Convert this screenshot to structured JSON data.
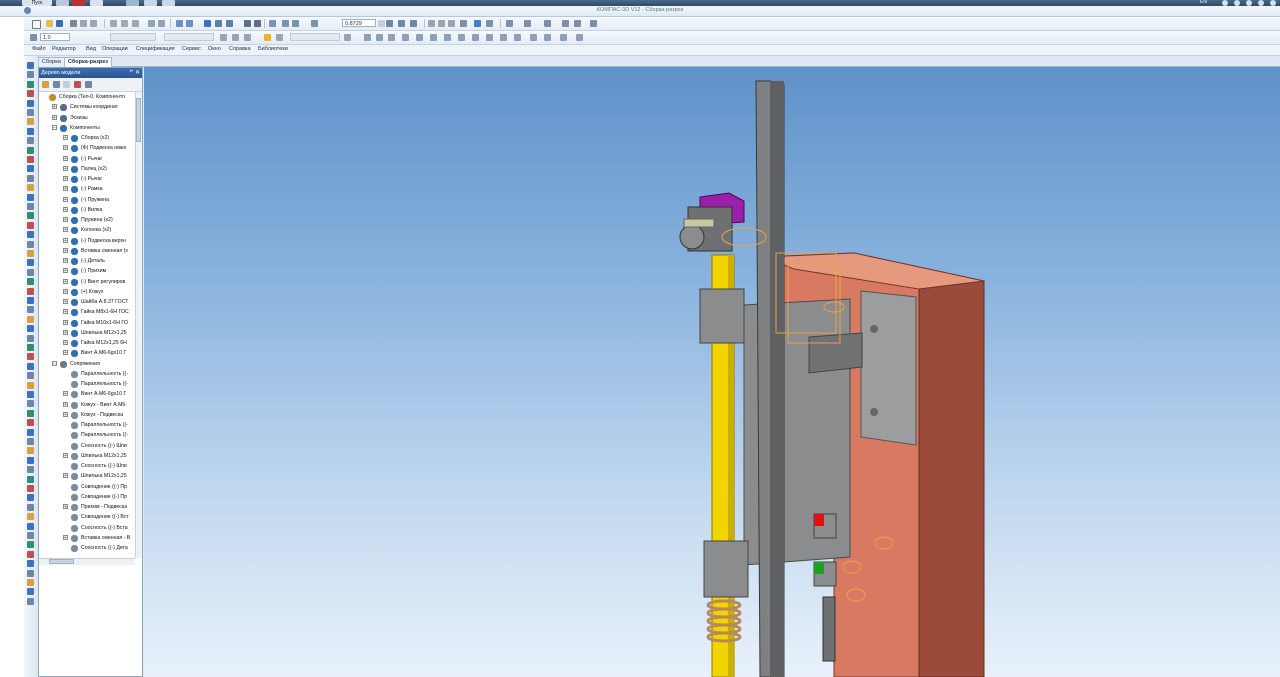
{
  "taskbar": {
    "start_label": "Пуск",
    "tray_text": "EN"
  },
  "app": {
    "title": "КОМПАС-3D V12 - Сборка-разрез"
  },
  "toolbar": {
    "zoom_value": "0.8729",
    "scale_value": "1.0"
  },
  "menu": [
    "Файл",
    "Редактор",
    "Вид",
    "Операции",
    "Спецификация",
    "Сервис",
    "Окно",
    "Справка",
    "Библиотеки"
  ],
  "doc_tabs": [
    {
      "label": "Сборка",
      "active": false
    },
    {
      "label": "Сборка-разрез",
      "active": true
    }
  ],
  "tree": {
    "title": "Дерево модели",
    "pin": "ꟸ",
    "close": "✕",
    "rows": [
      {
        "label": "Сборка (Тел-0, Компоненто",
        "indent": 0,
        "exp": "",
        "icon": "assembly-root-icon",
        "color": "#c98a2a"
      },
      {
        "label": "Системы координат",
        "indent": 1,
        "exp": "+",
        "icon": "coordinate-system-icon",
        "color": "#5a6a8a"
      },
      {
        "label": "Эскизы",
        "indent": 1,
        "exp": "+",
        "icon": "sketch-icon",
        "color": "#5a6a8a"
      },
      {
        "label": "Компоненты",
        "indent": 1,
        "exp": "−",
        "icon": "components-icon",
        "color": "#2f6fb5"
      },
      {
        "label": "Сборка (x2)",
        "indent": 2,
        "exp": "+",
        "icon": "assembly-icon",
        "color": "#2f6fb5"
      },
      {
        "label": "(Ф) Подвеска нижн",
        "indent": 2,
        "exp": "+",
        "icon": "part-icon",
        "color": "#2f6fb5"
      },
      {
        "label": "(-) Рычаг",
        "indent": 2,
        "exp": "+",
        "icon": "part-icon",
        "color": "#2f6fb5"
      },
      {
        "label": "Палец (x2)",
        "indent": 2,
        "exp": "+",
        "icon": "part-icon",
        "color": "#2f6fb5"
      },
      {
        "label": "(-) Рычаг",
        "indent": 2,
        "exp": "+",
        "icon": "part-icon",
        "color": "#2f6fb5"
      },
      {
        "label": "(-) Рамка",
        "indent": 2,
        "exp": "+",
        "icon": "part-icon",
        "color": "#2f6fb5"
      },
      {
        "label": "(-) Пружина",
        "indent": 2,
        "exp": "+",
        "icon": "part-icon",
        "color": "#2f6fb5"
      },
      {
        "label": "(-) Вилка",
        "indent": 2,
        "exp": "+",
        "icon": "part-icon",
        "color": "#2f6fb5"
      },
      {
        "label": "Пружина (x2)",
        "indent": 2,
        "exp": "+",
        "icon": "part-icon",
        "color": "#2f6fb5"
      },
      {
        "label": "Колонка (x2)",
        "indent": 2,
        "exp": "+",
        "icon": "part-icon",
        "color": "#2f6fb5"
      },
      {
        "label": "(-) Подвеска верхн",
        "indent": 2,
        "exp": "+",
        "icon": "part-icon",
        "color": "#2f6fb5"
      },
      {
        "label": "Вставка сменная (x",
        "indent": 2,
        "exp": "+",
        "icon": "part-icon",
        "color": "#2f6fb5"
      },
      {
        "label": "(-) Деталь",
        "indent": 2,
        "exp": "+",
        "icon": "part-icon",
        "color": "#2f6fb5"
      },
      {
        "label": "(-) Прихим",
        "indent": 2,
        "exp": "+",
        "icon": "part-icon",
        "color": "#2f6fb5"
      },
      {
        "label": "(-) Винт регулиров",
        "indent": 2,
        "exp": "+",
        "icon": "part-icon",
        "color": "#2f6fb5"
      },
      {
        "label": "(+) Кожух",
        "indent": 2,
        "exp": "+",
        "icon": "part-icon",
        "color": "#2f6fb5"
      },
      {
        "label": "Шайба А.8.37 ГОСТ",
        "indent": 2,
        "exp": "+",
        "icon": "std-part-icon",
        "color": "#2f6fb5"
      },
      {
        "label": "Гайка М8х1-6Н ГОС",
        "indent": 2,
        "exp": "+",
        "icon": "std-part-icon",
        "color": "#2f6fb5"
      },
      {
        "label": "Гайка М10х1-6Н ГО",
        "indent": 2,
        "exp": "+",
        "icon": "std-part-icon",
        "color": "#2f6fb5"
      },
      {
        "label": "Шпилька М12х1,25",
        "indent": 2,
        "exp": "+",
        "icon": "std-part-icon",
        "color": "#2f6fb5"
      },
      {
        "label": "Гайка М12х1,25 6Н",
        "indent": 2,
        "exp": "+",
        "icon": "std-part-icon",
        "color": "#2f6fb5"
      },
      {
        "label": "Винт А.М6-6gх10 Г",
        "indent": 2,
        "exp": "+",
        "icon": "std-part-icon",
        "color": "#2f6fb5"
      },
      {
        "label": "Сопряжения",
        "indent": 1,
        "exp": "−",
        "icon": "mates-icon",
        "color": "#6a7a8a"
      },
      {
        "label": "Параллельность ((-",
        "indent": 2,
        "exp": "",
        "icon": "mate-icon",
        "color": "#7a8aa0"
      },
      {
        "label": "Параллельность ((-",
        "indent": 2,
        "exp": "",
        "icon": "mate-icon",
        "color": "#7a8aa0"
      },
      {
        "label": "Винт А.М6-6gх10 Г",
        "indent": 2,
        "exp": "+",
        "icon": "mate-icon",
        "color": "#7a8aa0"
      },
      {
        "label": "Кожух - Винт А.М6-",
        "indent": 2,
        "exp": "+",
        "icon": "mate-icon",
        "color": "#7a8aa0"
      },
      {
        "label": "Кожух - Подвеска",
        "indent": 2,
        "exp": "+",
        "icon": "mate-icon",
        "color": "#7a8aa0"
      },
      {
        "label": "Параллельность ((-",
        "indent": 2,
        "exp": "",
        "icon": "mate-icon",
        "color": "#7a8aa0"
      },
      {
        "label": "Параллельность ((-",
        "indent": 2,
        "exp": "",
        "icon": "mate-icon",
        "color": "#7a8aa0"
      },
      {
        "label": "Соосность ((-) Шпи",
        "indent": 2,
        "exp": "",
        "icon": "mate-icon",
        "color": "#7a8aa0"
      },
      {
        "label": "Шпилька М12х1,25",
        "indent": 2,
        "exp": "+",
        "icon": "mate-icon",
        "color": "#7a8aa0"
      },
      {
        "label": "Соосность ((-) Шпи",
        "indent": 2,
        "exp": "",
        "icon": "mate-icon",
        "color": "#7a8aa0"
      },
      {
        "label": "Шпилька М12х1,25",
        "indent": 2,
        "exp": "+",
        "icon": "mate-icon",
        "color": "#7a8aa0"
      },
      {
        "label": "Совпадение ((-) Пр",
        "indent": 2,
        "exp": "",
        "icon": "mate-icon",
        "color": "#7a8aa0"
      },
      {
        "label": "Совпадение ((-) Пр",
        "indent": 2,
        "exp": "",
        "icon": "mate-icon",
        "color": "#7a8aa0"
      },
      {
        "label": "Прихим - Подвеска",
        "indent": 2,
        "exp": "+",
        "icon": "mate-icon",
        "color": "#7a8aa0"
      },
      {
        "label": "Совпадение ((-) Вст",
        "indent": 2,
        "exp": "",
        "icon": "mate-icon",
        "color": "#7a8aa0"
      },
      {
        "label": "Соосность ((-) Вста",
        "indent": 2,
        "exp": "",
        "icon": "mate-icon",
        "color": "#7a8aa0"
      },
      {
        "label": "Вставка сменная - В",
        "indent": 2,
        "exp": "+",
        "icon": "mate-icon",
        "color": "#7a8aa0"
      },
      {
        "label": "Соосность ((-) Дета",
        "indent": 2,
        "exp": "",
        "icon": "mate-icon",
        "color": "#7a8aa0"
      }
    ]
  },
  "colors": {
    "accent": "#2a5492",
    "viewport_top": "#5f92c9",
    "viewport_bottom": "#e8f1fa",
    "part_gray": "#8a8c8e",
    "part_yellow": "#f2d400",
    "part_copper": "#d87a62",
    "part_purple": "#9b1fa8",
    "indicator_red": "#e01010",
    "indicator_green": "#1ea020"
  }
}
